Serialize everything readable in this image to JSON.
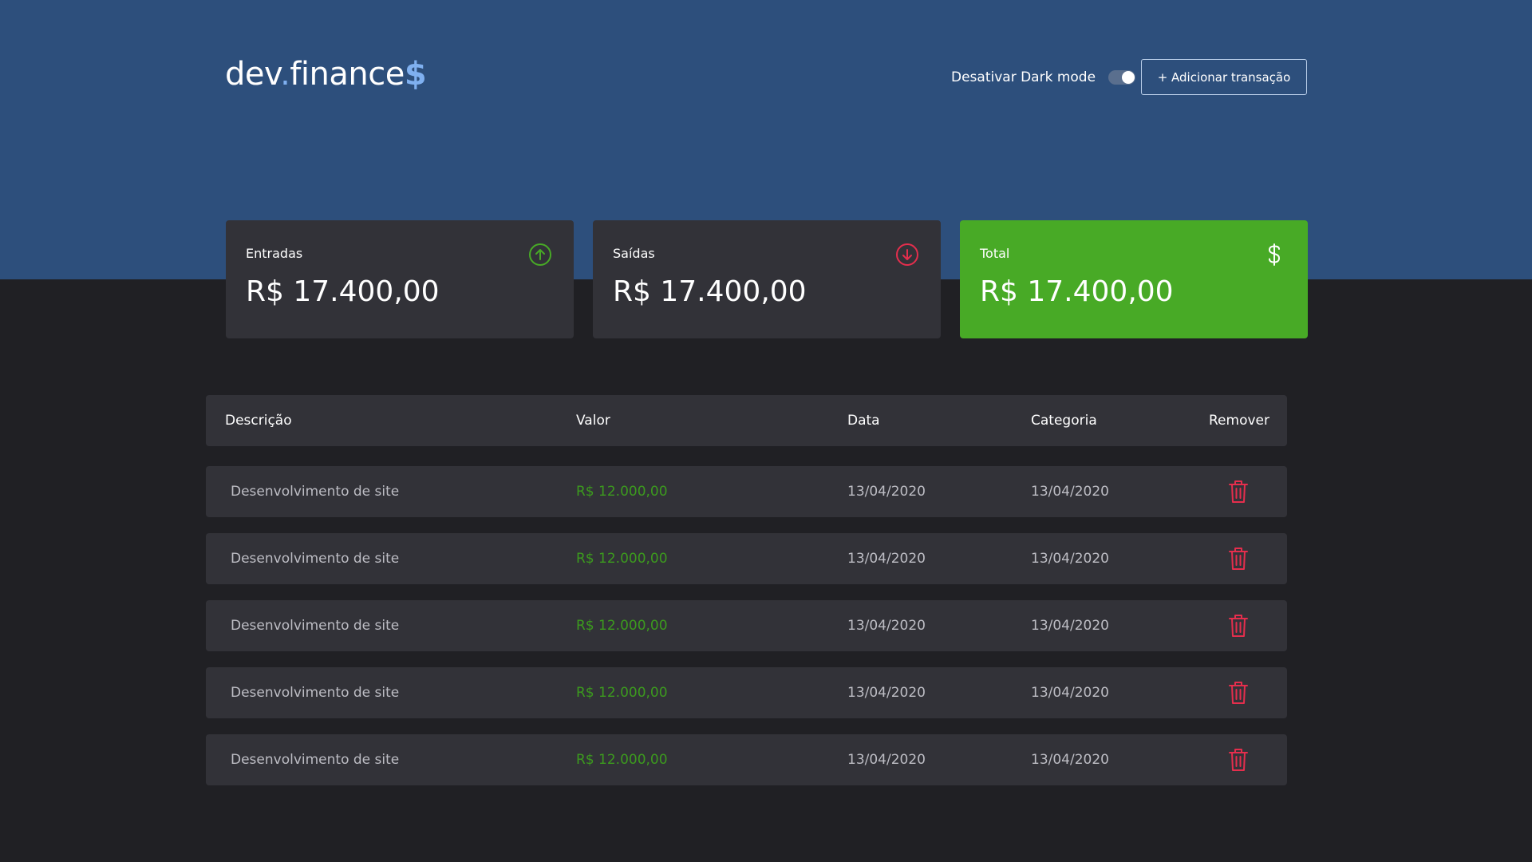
{
  "header": {
    "logo_main": "dev",
    "logo_dot": ".",
    "logo_rest": "finance",
    "logo_symbol": "$",
    "dark_mode_label": "Desativar Dark mode",
    "add_button_label": "+ Adicionar transação"
  },
  "cards": [
    {
      "label": "Entradas",
      "value": "R$ 17.400,00",
      "icon": "arrow-up-circle-icon",
      "icon_color": "#48aa26"
    },
    {
      "label": "Saídas",
      "value": "R$ 17.400,00",
      "icon": "arrow-down-circle-icon",
      "icon_color": "#e52e4d"
    },
    {
      "label": "Total",
      "value": "R$ 17.400,00",
      "icon": "dollar-icon",
      "icon_color": "#ffffff"
    }
  ],
  "table": {
    "columns": [
      "Descrição",
      "Valor",
      "Data",
      "Categoria",
      "Remover"
    ],
    "rows": [
      {
        "description": "Desenvolvimento de site",
        "amount": "R$ 12.000,00",
        "date": "13/04/2020",
        "category": "13/04/2020"
      },
      {
        "description": "Desenvolvimento de site",
        "amount": "R$ 12.000,00",
        "date": "13/04/2020",
        "category": "13/04/2020"
      },
      {
        "description": "Desenvolvimento de site",
        "amount": "R$ 12.000,00",
        "date": "13/04/2020",
        "category": "13/04/2020"
      },
      {
        "description": "Desenvolvimento de site",
        "amount": "R$ 12.000,00",
        "date": "13/04/2020",
        "category": "13/04/2020"
      },
      {
        "description": "Desenvolvimento de site",
        "amount": "R$ 12.000,00",
        "date": "13/04/2020",
        "category": "13/04/2020"
      }
    ]
  },
  "colors": {
    "header_bg": "#2d4f7c",
    "page_bg": "#202024",
    "card_bg": "#323238",
    "total_bg": "#48aa26",
    "income": "#3c9a1e",
    "remove": "#e52e4d"
  }
}
